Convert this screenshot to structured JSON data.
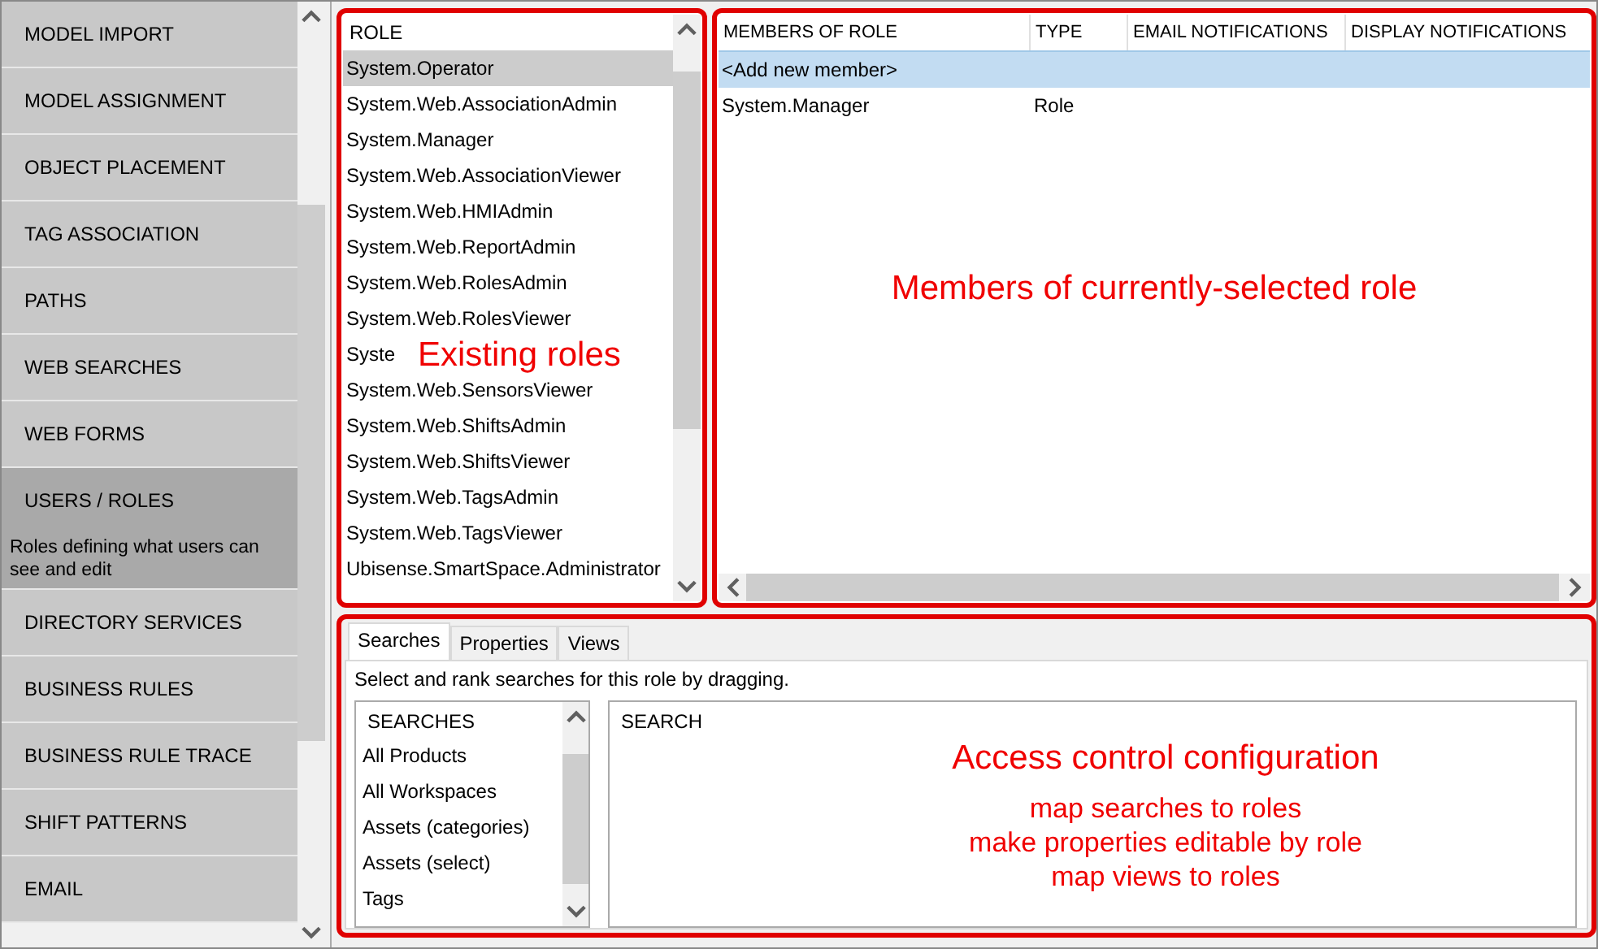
{
  "sidebar": {
    "items": [
      {
        "label": "MODEL IMPORT",
        "selected": false
      },
      {
        "label": "MODEL ASSIGNMENT",
        "selected": false
      },
      {
        "label": "OBJECT PLACEMENT",
        "selected": false
      },
      {
        "label": "TAG ASSOCIATION",
        "selected": false
      },
      {
        "label": "PATHS",
        "selected": false
      },
      {
        "label": "WEB SEARCHES",
        "selected": false
      },
      {
        "label": "WEB FORMS",
        "selected": false
      },
      {
        "label": "USERS / ROLES",
        "selected": true,
        "description": "Roles defining what users can see and edit"
      },
      {
        "label": "DIRECTORY SERVICES",
        "selected": false
      },
      {
        "label": "BUSINESS RULES",
        "selected": false
      },
      {
        "label": "BUSINESS RULE TRACE",
        "selected": false
      },
      {
        "label": "SHIFT PATTERNS",
        "selected": false
      },
      {
        "label": "EMAIL",
        "selected": false
      }
    ]
  },
  "roles": {
    "header": "ROLE",
    "items": [
      {
        "label": "System.Operator",
        "selected": true
      },
      {
        "label": "System.Web.AssociationAdmin",
        "selected": false
      },
      {
        "label": "System.Manager",
        "selected": false
      },
      {
        "label": "System.Web.AssociationViewer",
        "selected": false
      },
      {
        "label": "System.Web.HMIAdmin",
        "selected": false
      },
      {
        "label": "System.Web.ReportAdmin",
        "selected": false
      },
      {
        "label": "System.Web.RolesAdmin",
        "selected": false
      },
      {
        "label": "System.Web.RolesViewer",
        "selected": false
      },
      {
        "label": "Syste",
        "selected": false
      },
      {
        "label": "System.Web.SensorsViewer",
        "selected": false
      },
      {
        "label": "System.Web.ShiftsAdmin",
        "selected": false
      },
      {
        "label": "System.Web.ShiftsViewer",
        "selected": false
      },
      {
        "label": "System.Web.TagsAdmin",
        "selected": false
      },
      {
        "label": "System.Web.TagsViewer",
        "selected": false
      },
      {
        "label": "Ubisense.SmartSpace.Administrator",
        "selected": false
      }
    ]
  },
  "members": {
    "columns": [
      "MEMBERS OF ROLE",
      "TYPE",
      "EMAIL NOTIFICATIONS",
      "DISPLAY NOTIFICATIONS"
    ],
    "rows": [
      {
        "cells": [
          "<Add new member>"
        ],
        "selected": true
      },
      {
        "cells": [
          "System.Manager",
          "Role"
        ],
        "selected": false
      }
    ]
  },
  "tabs": [
    {
      "label": "Searches",
      "selected": true
    },
    {
      "label": "Properties",
      "selected": false
    },
    {
      "label": "Views",
      "selected": false
    }
  ],
  "instruction": "Select and rank searches for this role by dragging.",
  "searches": {
    "header": "SEARCHES",
    "items": [
      "All Products",
      "All Workspaces",
      "Assets (categories)",
      "Assets (select)",
      "Tags"
    ]
  },
  "search": {
    "header": "SEARCH"
  },
  "annotations": {
    "roles": "Existing roles",
    "members": "Members of currently-selected role",
    "access_title": "Access control configuration",
    "access_lines": [
      "map searches to roles",
      "make properties editable by role",
      "map views to roles"
    ]
  }
}
